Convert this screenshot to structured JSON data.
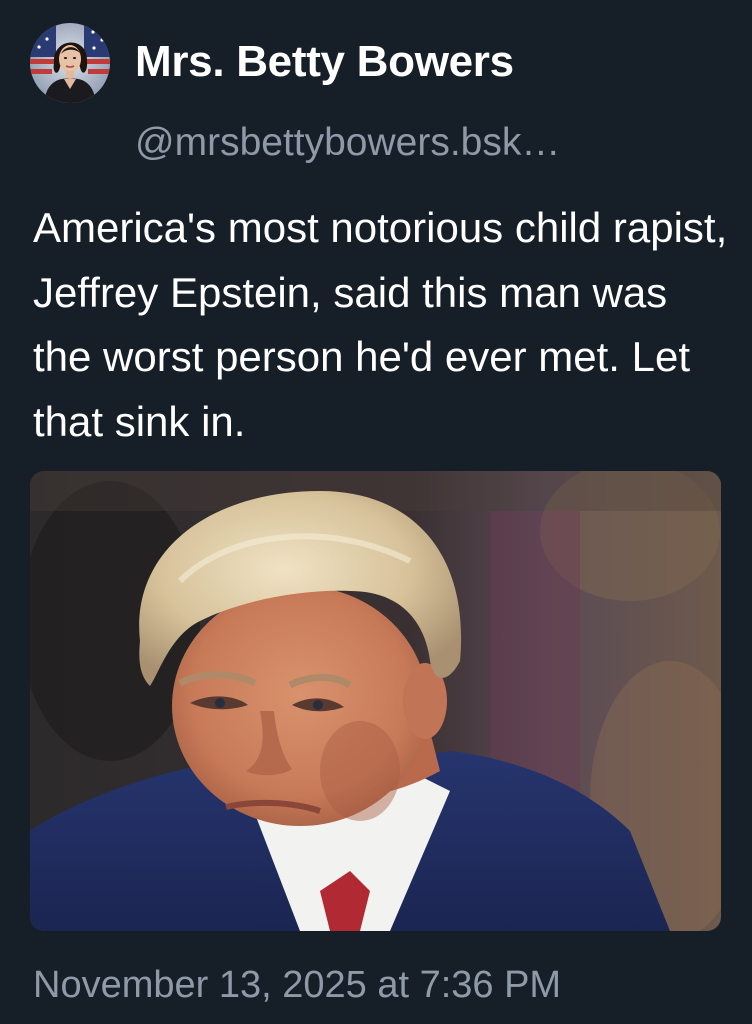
{
  "post": {
    "author": {
      "display_name": "Mrs. Betty Bowers",
      "handle": "@mrsbettybowers.bsk…",
      "avatar_icon": "profile-photo-avatar"
    },
    "text": "America's most notorious child rapist, Jeffrey Epstein, said this man was the worst person he'd ever met. Let that sink in.",
    "image": {
      "icon": "photo-of-man-in-blue-suit"
    },
    "timestamp": "November 13, 2025 at 7:36 PM"
  },
  "colors": {
    "background": "#161e27",
    "primary_text": "#ffffff",
    "secondary_text": "#8f9aa8"
  }
}
